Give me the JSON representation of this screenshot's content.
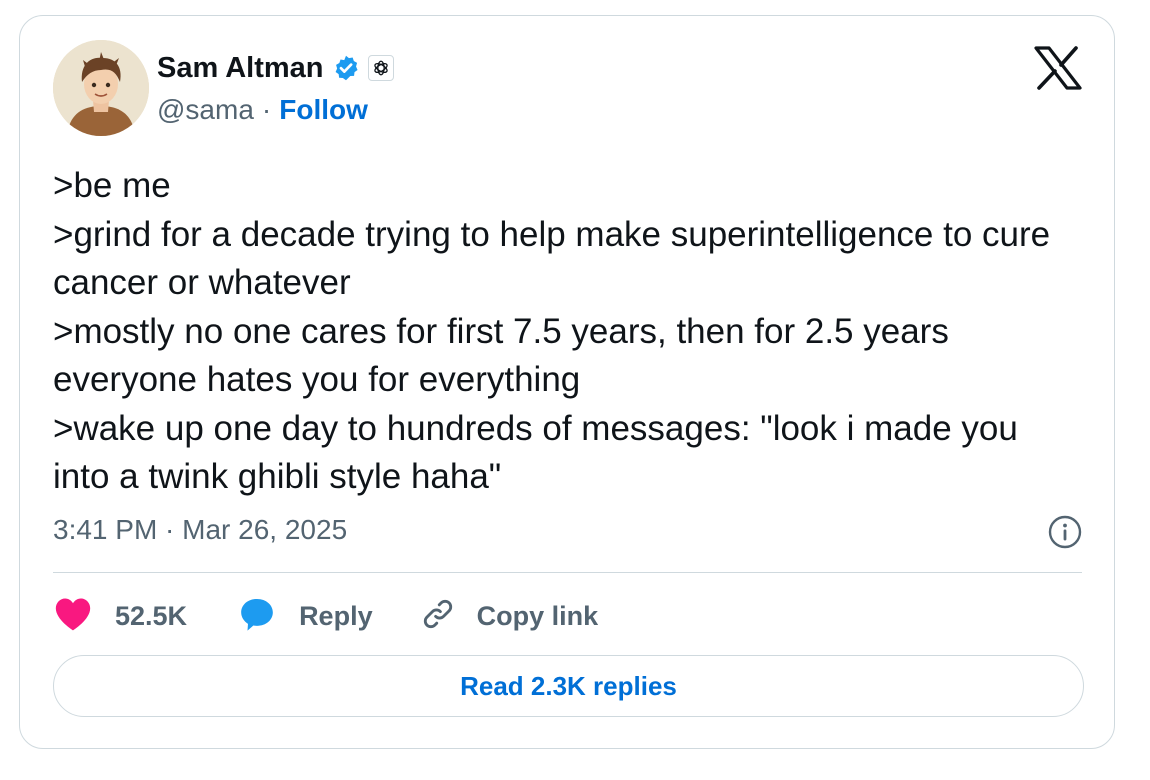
{
  "author": {
    "name": "Sam Altman",
    "handle": "@sama",
    "separator": "·",
    "follow_label": "Follow",
    "verified_color": "#1d9bf0",
    "affiliate_badge": "openai-logo-icon"
  },
  "tweet": {
    "text": ">be me\n>grind for a decade trying to help make superintelligence to cure cancer or whatever\n>mostly no one cares for first 7.5 years, then for 2.5 years everyone hates you for everything\n>wake up one day to hundreds of messages: \"look i made you into a twink ghibli style haha\"",
    "timestamp": "3:41 PM · Mar 26, 2025"
  },
  "actions": {
    "like_count": "52.5K",
    "reply_label": "Reply",
    "copy_label": "Copy link",
    "read_replies_label": "Read 2.3K replies"
  },
  "icons": {
    "brand": "x-logo-icon",
    "info": "info-icon",
    "like": "heart-icon",
    "reply": "speech-bubble-icon",
    "copy": "link-icon"
  },
  "colors": {
    "link_blue": "#006fd6",
    "like_pink": "#f91880",
    "reply_blue": "#1d9bf0",
    "muted_text": "#536471",
    "border": "#cfd9de"
  }
}
